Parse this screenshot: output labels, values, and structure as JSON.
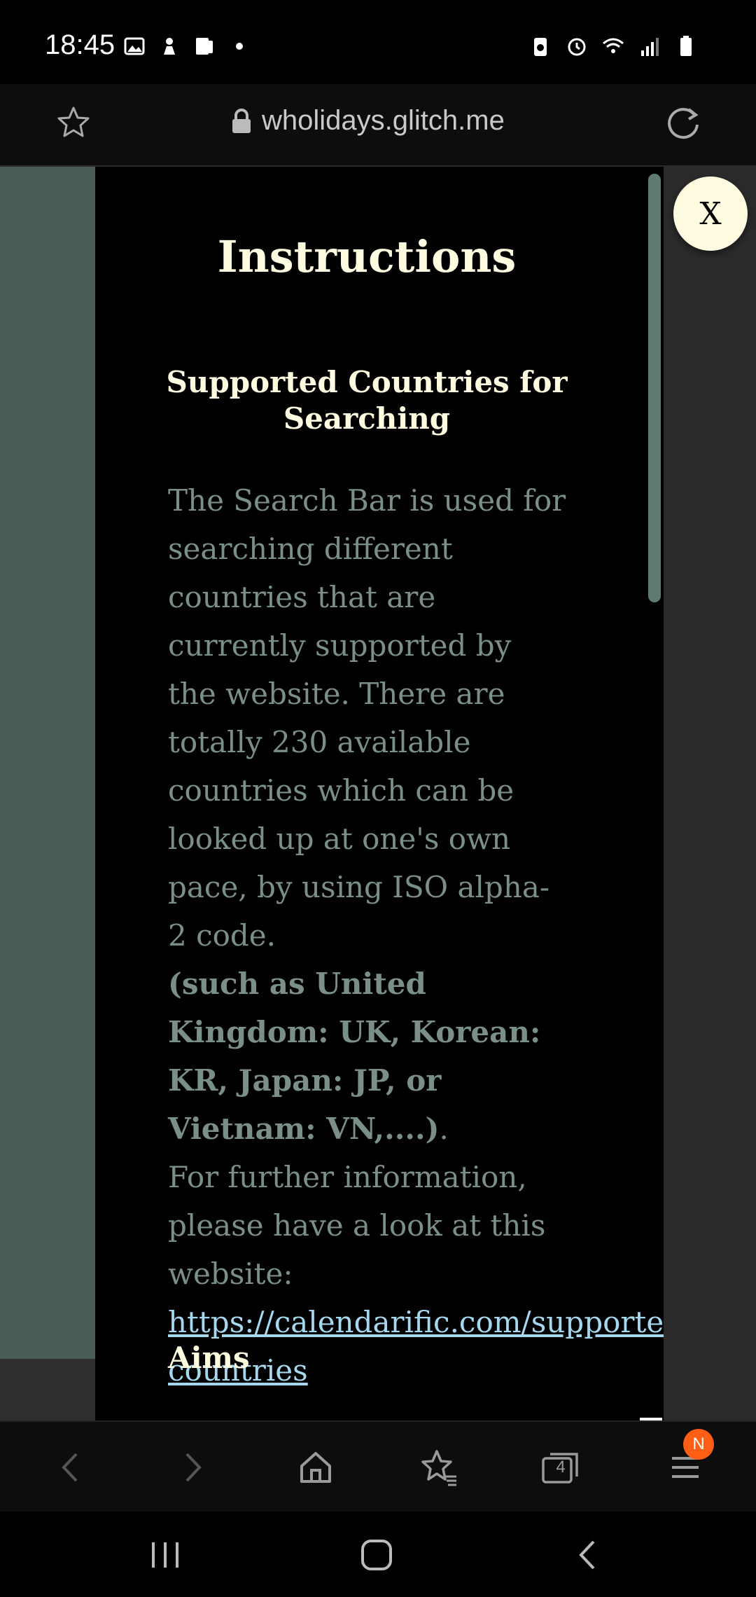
{
  "status_bar": {
    "time": "18:45",
    "icons_left": [
      "image-icon",
      "app-notification-icon",
      "phone-icon",
      "dot-icon"
    ],
    "icons_right": [
      "battery-saver-icon",
      "alarm-icon",
      "wifi-icon",
      "signal-icon",
      "battery-icon"
    ]
  },
  "browser": {
    "url": "wholidays.glitch.me",
    "tabs_count": "4",
    "menu_badge": "N"
  },
  "modal": {
    "title": "Instructions",
    "close_label": "X",
    "section_title": "Supported Countries for Searching",
    "paragraph_intro": "The Search Bar is used for searching different countries that are currently supported by the website. There are totally 230 available countries which can be looked up at one's own pace, by using ISO alpha-2 code.",
    "paragraph_bold": "(such as United Kingdom: UK, Korean: KR, Japan: JP, or Vietnam: VN,....)",
    "paragraph_bold_suffix": ".",
    "paragraph_more": "For further information, please have a look at this website:",
    "link_line1": "https://calendarific.com/supporte",
    "link_line2": "countries",
    "next_section_title": "Aims"
  },
  "colors": {
    "title": "#fffbe0",
    "body_text": "#7a8f88",
    "link": "#a5d8ef",
    "page_bg": "#4b5c57",
    "badge": "#ff5e14"
  }
}
